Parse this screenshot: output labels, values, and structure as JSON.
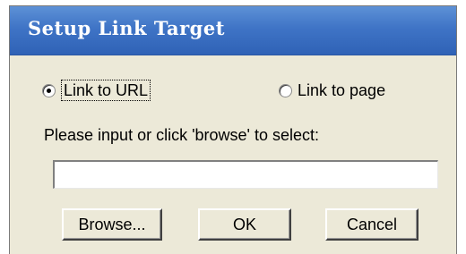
{
  "dialog": {
    "title": "Setup Link Target",
    "options": {
      "link_to_url": {
        "label": "Link to URL",
        "selected": true
      },
      "link_to_page": {
        "label": "Link to page",
        "selected": false
      }
    },
    "prompt": "Please input or click 'browse' to select:",
    "url_input": {
      "value": "",
      "placeholder": ""
    },
    "buttons": {
      "browse": "Browse...",
      "ok": "OK",
      "cancel": "Cancel"
    }
  }
}
